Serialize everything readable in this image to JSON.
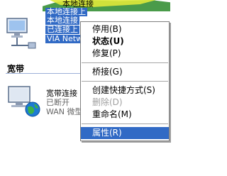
{
  "top_connection": {
    "labels": [
      "本地连接",
      "本地连接上",
      "本地连接",
      "已连接上",
      "VIA Netw"
    ]
  },
  "section_title": "宽带",
  "broadband": {
    "name": "宽带连接",
    "status": "已断开",
    "device": "WAN 微型"
  },
  "context_menu": {
    "items": [
      {
        "label": "停用(B)",
        "bold": false,
        "disabled": false
      },
      {
        "label": "状态(U)",
        "bold": true,
        "disabled": false
      },
      {
        "label": "修复(P)",
        "bold": false,
        "disabled": false
      },
      {
        "label": "桥接(G)",
        "bold": false,
        "disabled": false
      },
      {
        "label": "创建快捷方式(S)",
        "bold": false,
        "disabled": false
      },
      {
        "label": "删除(D)",
        "bold": false,
        "disabled": true
      },
      {
        "label": "重命名(M)",
        "bold": false,
        "disabled": false
      },
      {
        "label": "属性(R)",
        "bold": false,
        "disabled": false,
        "highlighted": true
      }
    ]
  },
  "colors": {
    "selection": "#316ac5",
    "menu_border": "#808080"
  }
}
